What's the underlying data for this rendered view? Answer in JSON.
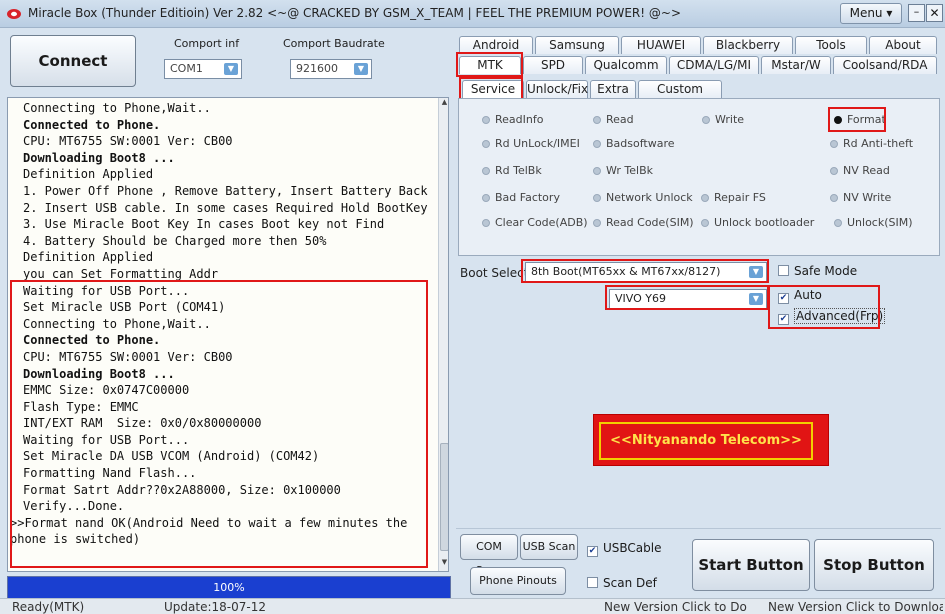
{
  "title": "Miracle Box (Thunder Editioin) Ver 2.82 <~@ CRACKED BY GSM_X_TEAM | FEEL THE PREMIUM POWER! @~>",
  "menu_label": "Menu ▾",
  "window_controls": {
    "minimize": "–",
    "close": "✕"
  },
  "connect_button": "Connect Button",
  "comport": {
    "label": "Comport inf",
    "value": "COM1"
  },
  "baudrate": {
    "label": "Comport Baudrate",
    "value": "921600"
  },
  "log": {
    "lines": [
      "Connecting to Phone,Wait..",
      "Connected to Phone.",
      "CPU: MT6755 SW:0001 Ver: CB00",
      "Downloading Boot8 ...",
      "Definition Applied",
      "1. Power Off Phone , Remove Battery, Insert Battery Back",
      "2. Insert USB cable. In some cases Required Hold BootKey",
      "3. Use Miracle Boot Key In cases Boot key not Find",
      "4. Battery Should be Charged more then 50%",
      "Definition Applied",
      "you can Set Formatting Addr",
      "Waiting for USB Port...",
      "Set Miracle USB Port (COM41)",
      "Connecting to Phone,Wait..",
      "Connected to Phone.",
      "CPU: MT6755 SW:0001 Ver: CB00",
      "Downloading Boot8 ...",
      "EMMC Size: 0x0747C00000",
      "Flash Type: EMMC",
      "INT/EXT RAM  Size: 0x0/0x80000000",
      "Waiting for USB Port...",
      "Set Miracle DA USB VCOM (Android) (COM42)",
      "Formatting Nand Flash...",
      "Format Satrt Addr??0x2A88000, Size: 0x100000",
      "Verify...Done.",
      ">>Format nand OK(Android Need to wait a few minutes the",
      "phone is switched)"
    ]
  },
  "progress": {
    "label": "100%",
    "value": 1.0
  },
  "tabs_row1": [
    "Android",
    "Samsung",
    "HUAWEI",
    "Blackberry",
    "Tools",
    "About"
  ],
  "tabs_row2": [
    "MTK",
    "SPD",
    "Qualcomm",
    "CDMA/LG/MI",
    "Mstar/W",
    "Coolsand/RDA"
  ],
  "tabs_row3": [
    "Service",
    "Unlock/Fix",
    "Extra",
    "Custom Setting"
  ],
  "functions": {
    "row1": [
      "ReadInfo",
      "Read",
      "Write",
      "Format"
    ],
    "row2": [
      "Rd UnLock/IMEI",
      "Badsoftware",
      "Rd Anti-theft"
    ],
    "row3": [
      "Rd TelBk",
      "Wr TelBk",
      "NV Read"
    ],
    "row4": [
      "Bad Factory",
      "Network Unlock",
      "Repair FS",
      "NV Write"
    ],
    "row5": [
      "Clear Code(ADB)",
      "Read Code(SIM)",
      "Unlock bootloader",
      "Unlock(SIM)"
    ]
  },
  "boot_select": {
    "label": "Boot Select",
    "value": "8th Boot(MT65xx & MT67xx/8127)"
  },
  "model_select": {
    "value": "VIVO Y69"
  },
  "options": {
    "safe_mode": "Safe Mode",
    "auto": "Auto",
    "advanced": "Advanced(Frp)"
  },
  "banner": "<<Nityanando Telecom>>",
  "bottom": {
    "com_scan": "COM Scan",
    "usb_scan": "USB Scan",
    "usb_cable": "USBCable",
    "phone_pinouts": "Phone Pinouts",
    "scan_def": "Scan Def",
    "start": "Start Button",
    "stop": "Stop Button"
  },
  "status": {
    "ready": "Ready(MTK)",
    "update": "Update:18-07-12",
    "new_version_1": "New Version Click to Do",
    "new_version_2": "New Version Click to Download"
  }
}
